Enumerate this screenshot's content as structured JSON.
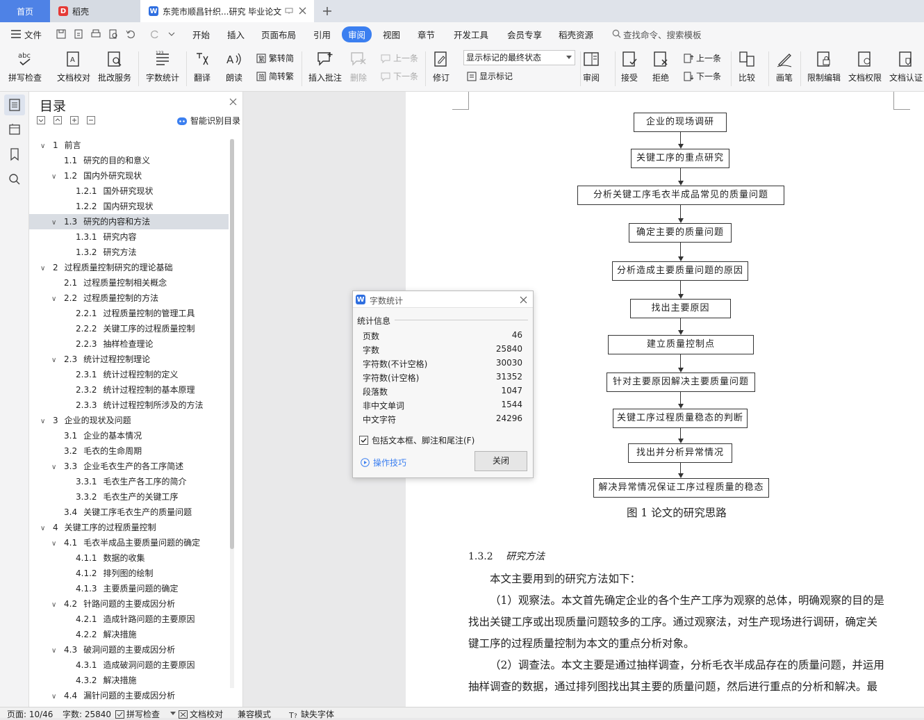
{
  "tabs": {
    "home": "首页",
    "daoke": "稻壳",
    "doc": "东莞市顺昌针织...研究 毕业论文"
  },
  "menu": {
    "file": "文件",
    "items": [
      "开始",
      "插入",
      "页面布局",
      "引用",
      "审阅",
      "视图",
      "章节",
      "开发工具",
      "会员专享",
      "稻壳资源"
    ],
    "search": "查找命令、搜索模板"
  },
  "ribbon": {
    "spellcheck": "拼写检查",
    "doccheck": "文档校对",
    "annotate_service": "批改服务",
    "wordcount": "字数统计",
    "translate": "翻译",
    "read": "朗读",
    "trad_simp": "繁转简",
    "simp_trad": "简转繁",
    "insert_comment": "插入批注",
    "delete": "删除",
    "prev1": "上一条",
    "next1": "下一条",
    "revise": "修订",
    "markup_select": "显示标记的最终状态",
    "show_markup": "显示标记",
    "review": "审阅",
    "accept": "接受",
    "reject": "拒绝",
    "prev2": "上一条",
    "next2": "下一条",
    "compare": "比较",
    "pen": "画笔",
    "restrict": "限制编辑",
    "permission": "文档权限",
    "certify": "文档认证"
  },
  "toc": {
    "title": "目录",
    "smart": "智能识别目录",
    "items": [
      {
        "num": "1",
        "text": "前言",
        "level": 1,
        "arrow": true
      },
      {
        "num": "1.1",
        "text": "研究的目的和意义",
        "level": 2,
        "arrow": false
      },
      {
        "num": "1.2",
        "text": "国内外研究现状",
        "level": 2,
        "arrow": true
      },
      {
        "num": "1.2.1",
        "text": "国外研究现状",
        "level": 3,
        "arrow": false
      },
      {
        "num": "1.2.2",
        "text": "国内研究现状",
        "level": 3,
        "arrow": false
      },
      {
        "num": "1.3",
        "text": "研究的内容和方法",
        "level": 2,
        "arrow": true,
        "selected": true
      },
      {
        "num": "1.3.1",
        "text": "研究内容",
        "level": 3,
        "arrow": false
      },
      {
        "num": "1.3.2",
        "text": "研究方法",
        "level": 3,
        "arrow": false
      },
      {
        "num": "2",
        "text": "过程质量控制研究的理论基础",
        "level": 1,
        "arrow": true
      },
      {
        "num": "2.1",
        "text": "过程质量控制相关概念",
        "level": 2,
        "arrow": false
      },
      {
        "num": "2.2",
        "text": "过程质量控制的方法",
        "level": 2,
        "arrow": true
      },
      {
        "num": "2.2.1",
        "text": "过程质量控制的管理工具",
        "level": 3,
        "arrow": false
      },
      {
        "num": "2.2.2",
        "text": "关键工序的过程质量控制",
        "level": 3,
        "arrow": false
      },
      {
        "num": "2.2.3",
        "text": "抽样检查理论",
        "level": 3,
        "arrow": false
      },
      {
        "num": "2.3",
        "text": "统计过程控制理论",
        "level": 2,
        "arrow": true
      },
      {
        "num": "2.3.1",
        "text": "统计过程控制的定义",
        "level": 3,
        "arrow": false
      },
      {
        "num": "2.3.2",
        "text": "统计过程控制的基本原理",
        "level": 3,
        "arrow": false
      },
      {
        "num": "2.3.3",
        "text": "统计过程控制所涉及的方法",
        "level": 3,
        "arrow": false
      },
      {
        "num": "3",
        "text": "企业的现状及问题",
        "level": 1,
        "arrow": true
      },
      {
        "num": "3.1",
        "text": "企业的基本情况",
        "level": 2,
        "arrow": false
      },
      {
        "num": "3.2",
        "text": "毛衣的生命周期",
        "level": 2,
        "arrow": false
      },
      {
        "num": "3.3",
        "text": "企业毛衣生产的各工序简述",
        "level": 2,
        "arrow": true
      },
      {
        "num": "3.3.1",
        "text": "毛衣生产各工序的简介",
        "level": 3,
        "arrow": false
      },
      {
        "num": "3.3.2",
        "text": "毛衣生产的关键工序",
        "level": 3,
        "arrow": false
      },
      {
        "num": "3.4",
        "text": "关键工序毛衣生产的质量问题",
        "level": 2,
        "arrow": false
      },
      {
        "num": "4",
        "text": "关键工序的过程质量控制",
        "level": 1,
        "arrow": true
      },
      {
        "num": "4.1",
        "text": "毛衣半成品主要质量问题的确定",
        "level": 2,
        "arrow": true
      },
      {
        "num": "4.1.1",
        "text": "数据的收集",
        "level": 3,
        "arrow": false
      },
      {
        "num": "4.1.2",
        "text": "排列图的绘制",
        "level": 3,
        "arrow": false
      },
      {
        "num": "4.1.3",
        "text": "主要质量问题的确定",
        "level": 3,
        "arrow": false
      },
      {
        "num": "4.2",
        "text": "针路问题的主要成因分析",
        "level": 2,
        "arrow": true
      },
      {
        "num": "4.2.1",
        "text": "造成针路问题的主要原因",
        "level": 3,
        "arrow": false
      },
      {
        "num": "4.2.2",
        "text": "解决措施",
        "level": 3,
        "arrow": false
      },
      {
        "num": "4.3",
        "text": "破洞问题的主要成因分析",
        "level": 2,
        "arrow": true
      },
      {
        "num": "4.3.1",
        "text": "造成破洞问题的主要原因",
        "level": 3,
        "arrow": false
      },
      {
        "num": "4.3.2",
        "text": "解决措施",
        "level": 3,
        "arrow": false
      },
      {
        "num": "4.4",
        "text": "漏针问题的主要成因分析",
        "level": 2,
        "arrow": true
      }
    ]
  },
  "flowchart": {
    "boxes": [
      "企业的现场调研",
      "关键工序的重点研究",
      "分析关键工序毛衣半成品常见的质量问题",
      "确定主要的质量问题",
      "分析造成主要质量问题的原因",
      "找出主要原因",
      "建立质量控制点",
      "针对主要原因解决主要质量问题",
      "关键工序过程质量稳态的判断",
      "找出并分析异常情况",
      "解决异常情况保证工序过程质量的稳态"
    ],
    "caption": "图 1    论文的研究思路"
  },
  "body": {
    "section_num": "1.3.2",
    "section_title": "研究方法",
    "lines": [
      "本文主要用到的研究方法如下：",
      "（1）观察法。本文首先确定企业的各个生产工序为观察的总体，明确观察的目的是",
      "找出关键工序或出现质量问题较多的工序。通过观察法，对生产现场进行调研，确定关",
      "键工序的过程质量控制为本文的重点分析对象。",
      "（2）调查法。本文主要是通过抽样调查，分析毛衣半成品存在的质量问题，并运用",
      "抽样调查的数据，通过排列图找出其主要的质量问题，然后进行重点的分析和解决。最"
    ]
  },
  "dialog": {
    "title": "字数统计",
    "section": "统计信息",
    "rows": [
      {
        "label": "页数",
        "value": "46"
      },
      {
        "label": "字数",
        "value": "25840"
      },
      {
        "label": "字符数(不计空格)",
        "value": "30030"
      },
      {
        "label": "字符数(计空格)",
        "value": "31352"
      },
      {
        "label": "段落数",
        "value": "1047"
      },
      {
        "label": "非中文单词",
        "value": "1544"
      },
      {
        "label": "中文字符",
        "value": "24296"
      }
    ],
    "checkbox": "包括文本框、脚注和尾注(F)",
    "tips": "操作技巧",
    "close": "关闭"
  },
  "status": {
    "page": "页面: 10/46",
    "words": "字数: 25840",
    "spell": "拼写检查",
    "check": "文档校对",
    "compat": "兼容模式",
    "missing_font": "缺失字体"
  }
}
